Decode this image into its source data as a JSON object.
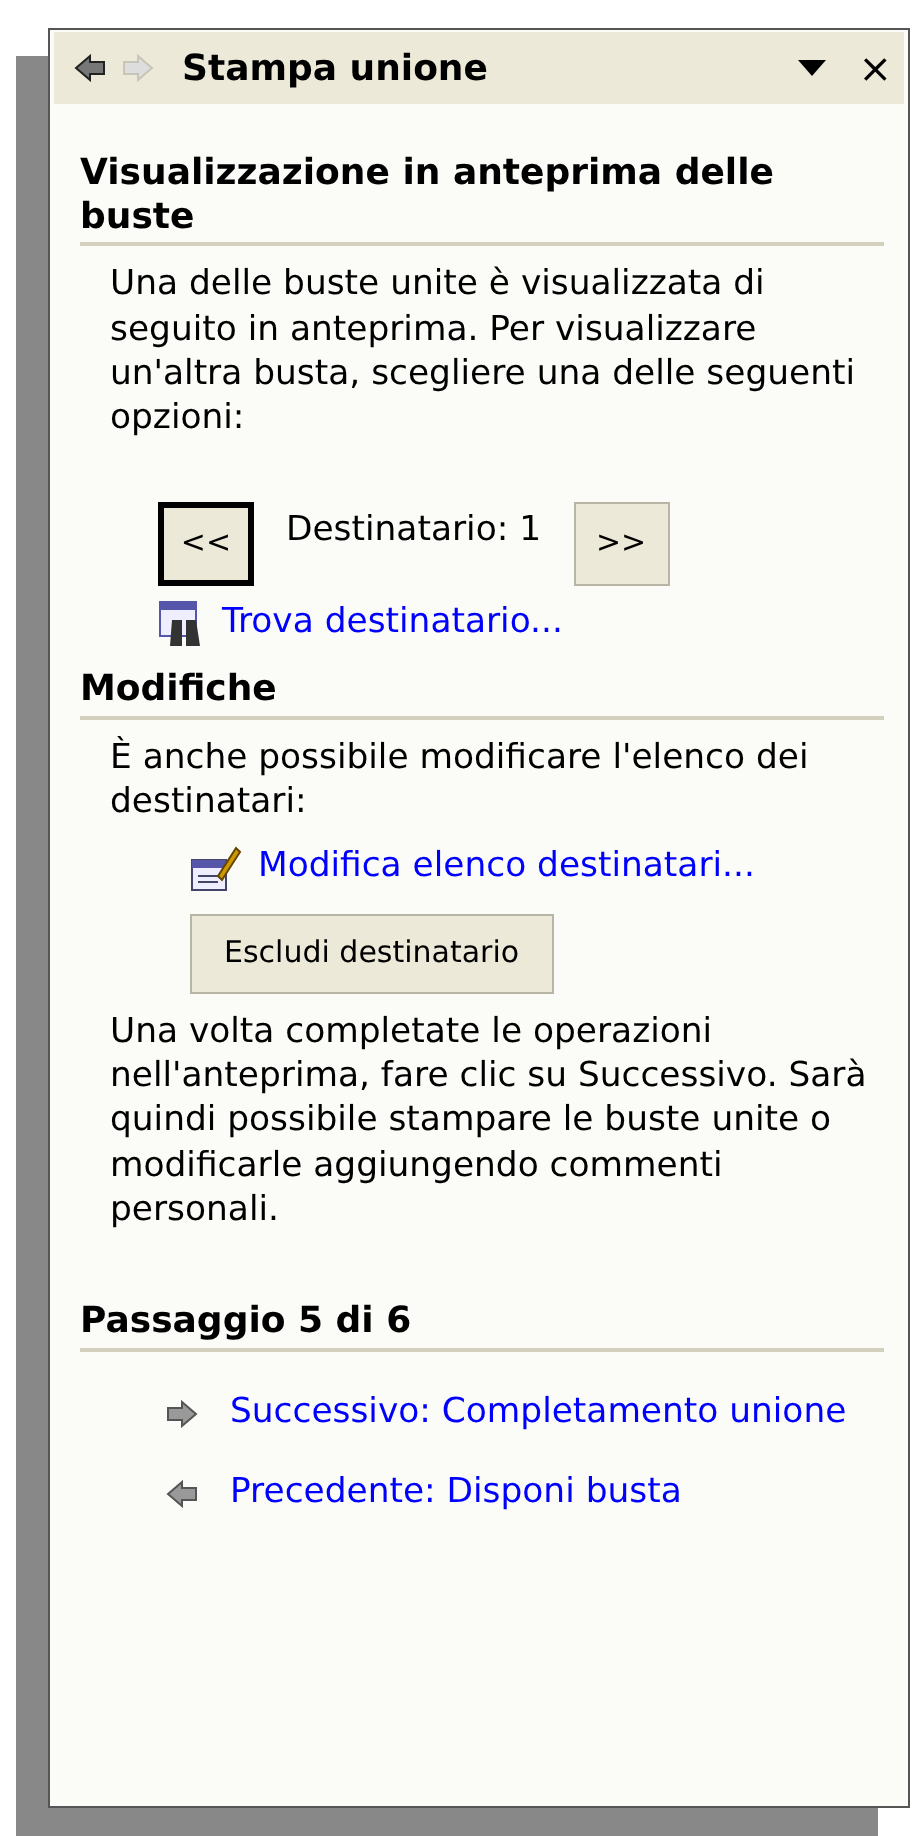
{
  "pane": {
    "title": "Stampa unione",
    "back_enabled": true,
    "forward_enabled": false,
    "close": "×"
  },
  "sections": [
    {
      "kind": "preview",
      "heading": "Visualizzazione in anteprima delle buste",
      "text": "Una delle buste unite è visualizzata di seguito in anteprima. Per visualizzare un'altra busta, scegliere una delle seguenti opzioni:",
      "prev": {
        "label": "<<",
        "focused": true
      },
      "recipient": "Destinatario: 1",
      "next": {
        "label": ">>",
        "focused": false
      },
      "link": "Trova destinatario..."
    },
    {
      "kind": "edit",
      "heading": "Modifiche",
      "text": "È anche possibile modificare l'elenco dei destinatari:",
      "link": "Modifica elenco destinatari...",
      "button": "Escludi destinatario",
      "note": "Una volta completate le operazioni nell'anteprima, fare clic su Successivo. Sarà quindi possibile stampare le buste unite o modificarle aggiungendo commenti personali."
    },
    {
      "kind": "steps",
      "heading": "Passaggio 5 di 6",
      "links": [
        {
          "kind": "next",
          "label": "Successivo: Completamento unione"
        },
        {
          "kind": "back",
          "label": "Precedente: Disponi busta"
        }
      ]
    }
  ]
}
